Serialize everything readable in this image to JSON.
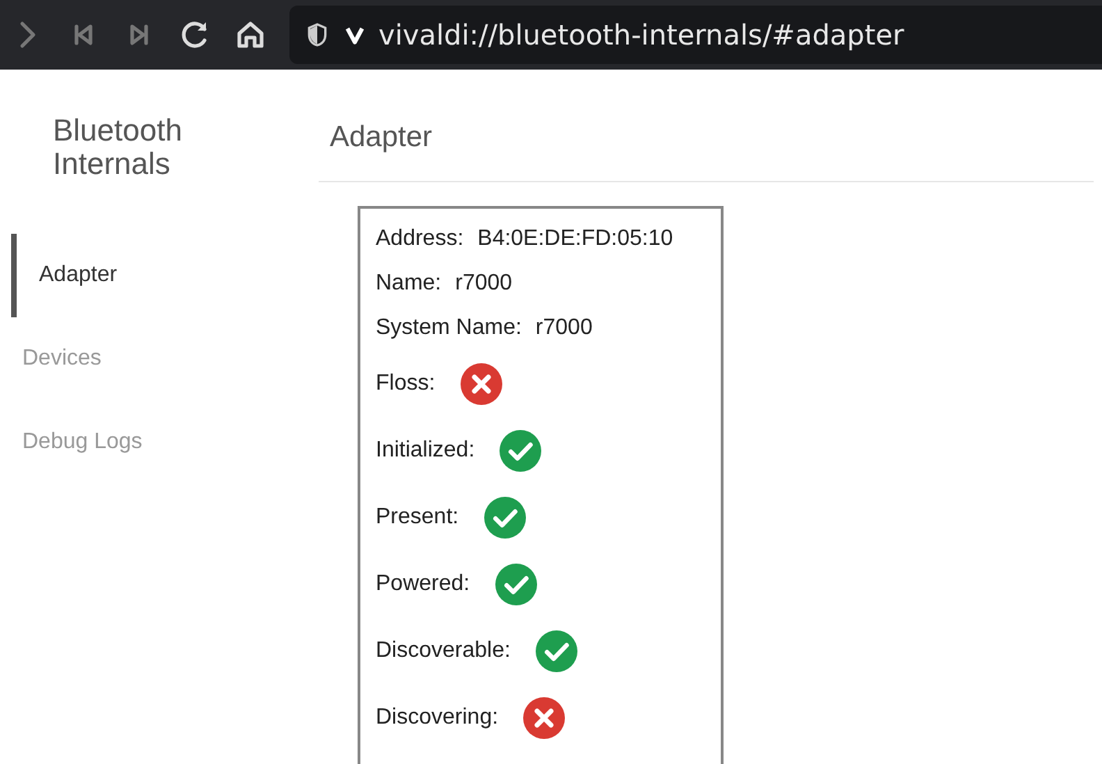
{
  "toolbar": {
    "url": "vivaldi://bluetooth-internals/#adapter"
  },
  "sidebar": {
    "title": "Bluetooth Internals",
    "items": [
      {
        "label": "Adapter",
        "selected": true
      },
      {
        "label": "Devices",
        "selected": false
      },
      {
        "label": "Debug Logs",
        "selected": false
      }
    ]
  },
  "page": {
    "heading": "Adapter",
    "properties": [
      {
        "kind": "text",
        "label": "Address:",
        "value": "B4:0E:DE:FD:05:10"
      },
      {
        "kind": "text",
        "label": "Name:",
        "value": "r7000"
      },
      {
        "kind": "text",
        "label": "System Name:",
        "value": "r7000"
      },
      {
        "kind": "bool",
        "label": "Floss:",
        "on": false
      },
      {
        "kind": "bool",
        "label": "Initialized:",
        "on": true
      },
      {
        "kind": "bool",
        "label": "Present:",
        "on": true
      },
      {
        "kind": "bool",
        "label": "Powered:",
        "on": true
      },
      {
        "kind": "bool",
        "label": "Discoverable:",
        "on": true
      },
      {
        "kind": "bool",
        "label": "Discovering:",
        "on": false
      }
    ]
  }
}
